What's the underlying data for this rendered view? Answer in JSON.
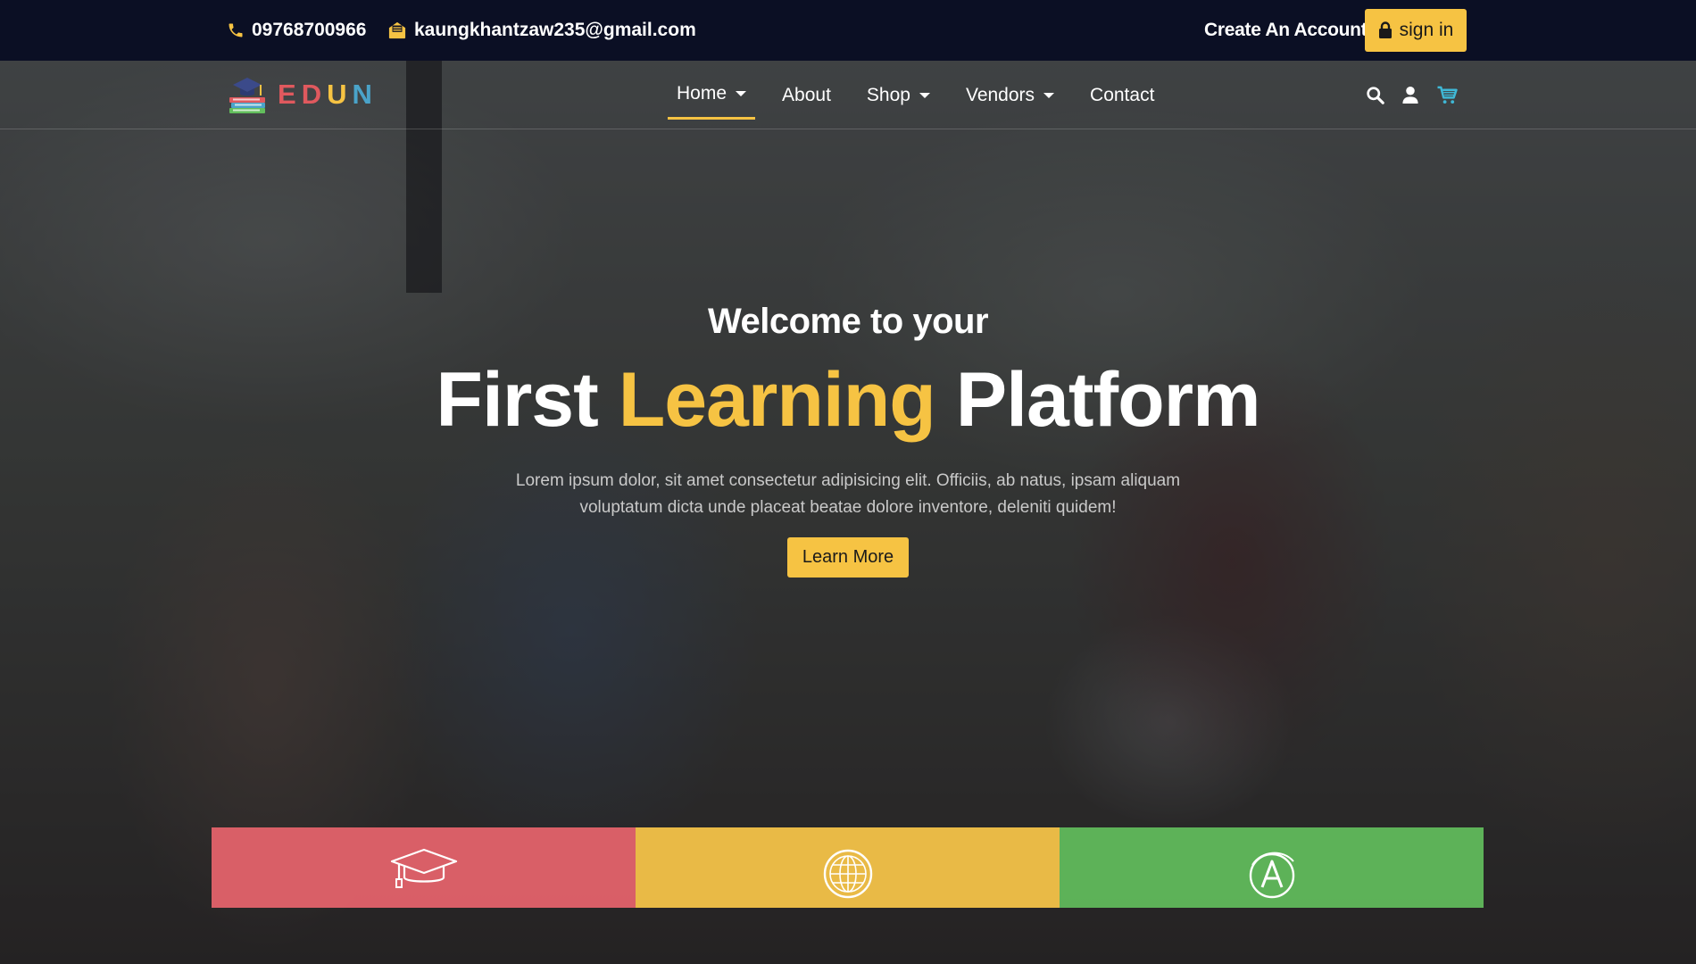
{
  "topbar": {
    "phone": "09768700966",
    "email": "kaungkhantzaw235@gmail.com",
    "create_account": "Create An Account",
    "signin": "sign in"
  },
  "nav": {
    "logo_letters": [
      "E",
      "D",
      "U",
      "N"
    ],
    "logo_colors": [
      "#e0595e",
      "#e0595e",
      "#f6c343",
      "#4aa3c9"
    ],
    "items": [
      {
        "label": "Home",
        "dropdown": true,
        "active": true
      },
      {
        "label": "About",
        "dropdown": false
      },
      {
        "label": "Shop",
        "dropdown": true
      },
      {
        "label": "Vendors",
        "dropdown": true
      },
      {
        "label": "Contact",
        "dropdown": false
      }
    ],
    "icons": [
      "search-icon",
      "user-icon",
      "cart-icon"
    ]
  },
  "hero": {
    "welcome": "Welcome to your",
    "title_first": "First",
    "title_highlight": "Learning",
    "title_last": "Platform",
    "description": "Lorem ipsum dolor, sit amet consectetur adipisicing elit. Officiis, ab natus, ipsam aliquam voluptatum dicta unde placeat beatae dolore inventore, deleniti quidem!",
    "button": "Learn More"
  },
  "features": [
    {
      "icon": "graduation-cap-icon",
      "color": "#e8646c"
    },
    {
      "icon": "globe-icon",
      "color": "#f5c448"
    },
    {
      "icon": "grade-a-icon",
      "color": "#62be5c"
    }
  ],
  "colors": {
    "accent": "#f6c343",
    "topbar": "#0b0f24",
    "cart": "#3fb8d6"
  }
}
